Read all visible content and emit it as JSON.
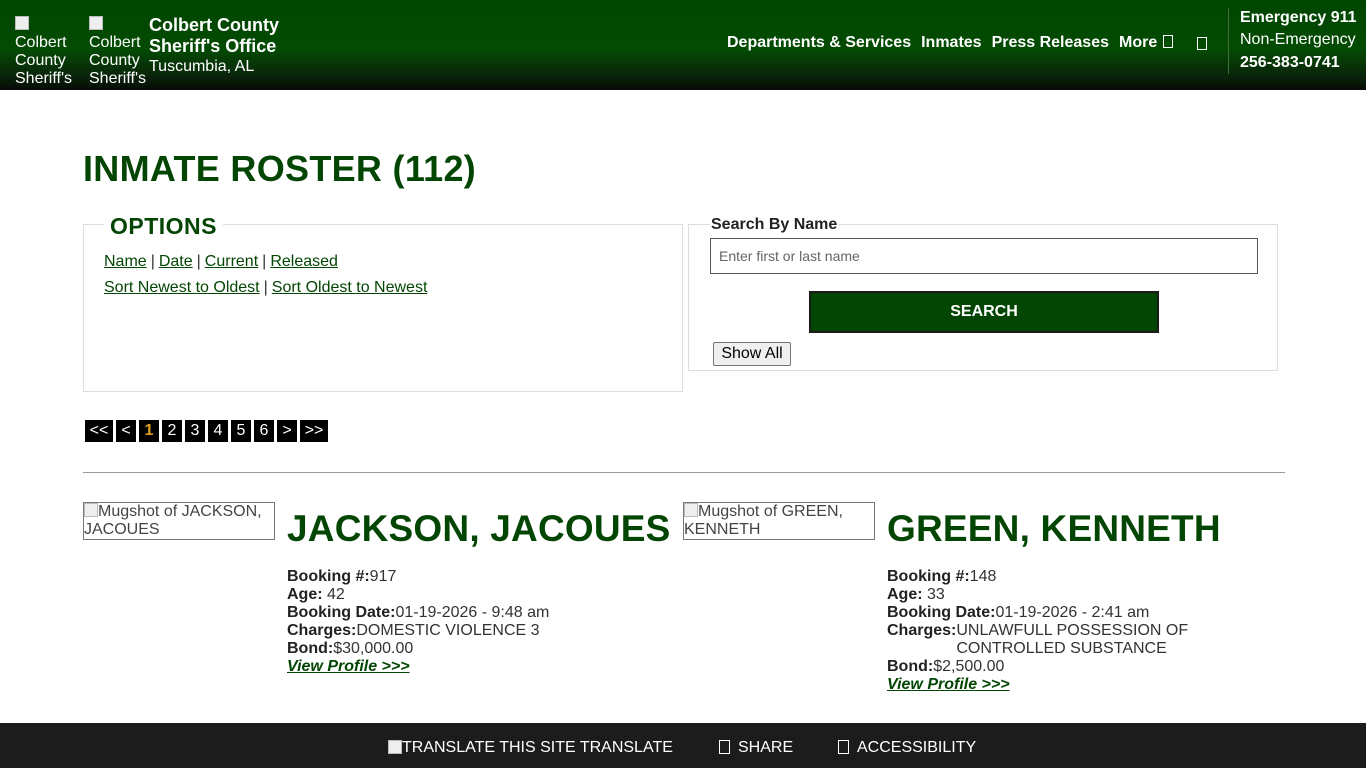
{
  "header": {
    "logo1_alt": "Colbert County Sheriff's Office",
    "logo2_alt": "Colbert County Sheriff's Office",
    "site_title": "Colbert County Sheriff's Office",
    "site_location": "Tuscumbia, AL",
    "nav": {
      "departments": "Departments & Services",
      "inmates": "Inmates",
      "press": "Press Releases",
      "more": "More"
    },
    "contact": {
      "emergency": "Emergency 911",
      "non_emergency_label": "Non-Emergency",
      "non_emergency_phone": "256-383-0741"
    },
    "brand_color": "#004600"
  },
  "page": {
    "title": "INMATE ROSTER (112)"
  },
  "options": {
    "legend": "OPTIONS",
    "filter_links": [
      "Name",
      "Date",
      "Current",
      "Released"
    ],
    "sort_links": [
      "Sort Newest to Oldest",
      "Sort Oldest to Newest"
    ],
    "separator": "|"
  },
  "search": {
    "label": "Search By Name",
    "placeholder": "Enter first or last name",
    "value": "",
    "button": "SEARCH",
    "show_all": "Show All"
  },
  "pagination": {
    "first": "<<",
    "prev": "<",
    "pages": [
      "1",
      "2",
      "3",
      "4",
      "5",
      "6"
    ],
    "current": "1",
    "next": ">",
    "last": ">>"
  },
  "inmates": [
    {
      "mugshot_alt": "Mugshot of JACKSON, JACOUES",
      "name": "JACKSON, JACOUES",
      "booking_label": "Booking #:",
      "booking": "917",
      "age_label": "Age:",
      "age": "42",
      "booking_date_label": "Booking Date:",
      "booking_date": "01-19-2026 - 9:48 am",
      "charges_label": "Charges:",
      "charges": "DOMESTIC VIOLENCE 3",
      "bond_label": "Bond:",
      "bond": "$30,000.00",
      "view_profile": "View Profile >>>"
    },
    {
      "mugshot_alt": "Mugshot of GREEN, KENNETH",
      "name": "GREEN, KENNETH",
      "booking_label": "Booking #:",
      "booking": "148",
      "age_label": "Age:",
      "age": "33",
      "booking_date_label": "Booking Date:",
      "booking_date": "01-19-2026 - 2:41 am",
      "charges_label": "Charges:",
      "charges": "UNLAWFULL POSSESSION OF CONTROLLED SUBSTANCE",
      "bond_label": "Bond:",
      "bond": "$2,500.00",
      "view_profile": "View Profile >>>"
    }
  ],
  "footer": {
    "translate_alt": "TRANSLATE THIS SITE",
    "translate": "TRANSLATE",
    "share": "SHARE",
    "accessibility": "ACCESSIBILITY"
  }
}
